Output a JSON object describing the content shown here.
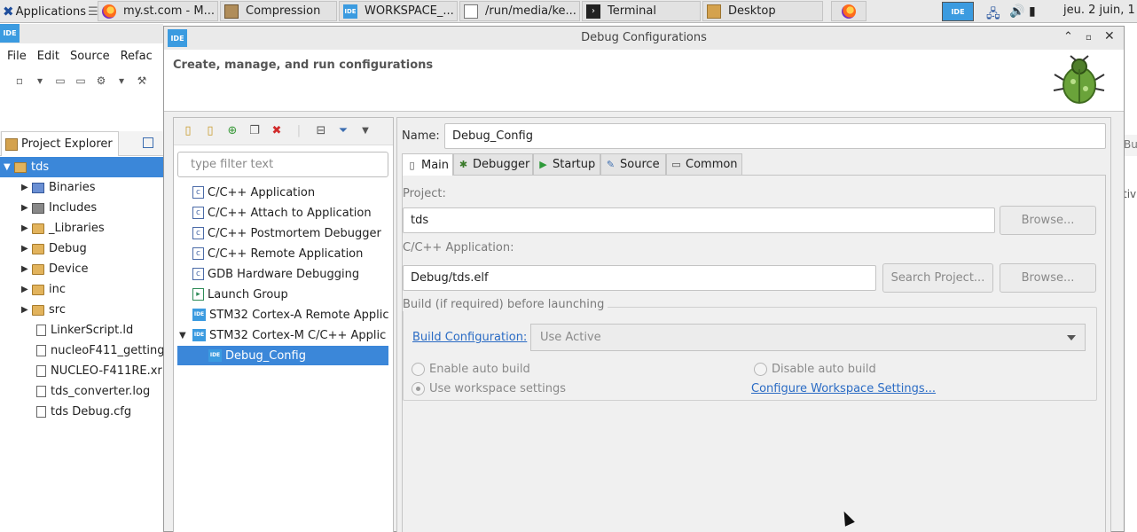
{
  "taskbar": {
    "applications_label": "Applications",
    "windows": [
      {
        "label": "my.st.com - M...",
        "icon": "firefox-icon"
      },
      {
        "label": "Compression",
        "icon": "archive-icon"
      },
      {
        "label": "WORKSPACE_...",
        "icon": "ide-icon"
      },
      {
        "label": "/run/media/ke...",
        "icon": "text-editor-icon"
      },
      {
        "label": "Terminal",
        "icon": "terminal-icon"
      },
      {
        "label": "Desktop",
        "icon": "folder-icon"
      }
    ],
    "clock": "jeu.  2 juin, 1"
  },
  "ide": {
    "badge": "IDE",
    "menu": [
      "File",
      "Edit",
      "Source",
      "Refac"
    ],
    "project_explorer": {
      "tab_label": "Project Explorer",
      "items": [
        {
          "label": "tds",
          "expanded": true,
          "selected": true,
          "icon": "project-icon"
        },
        {
          "label": "Binaries",
          "icon": "binaries-icon",
          "expandable": true
        },
        {
          "label": "Includes",
          "icon": "includes-icon",
          "expandable": true
        },
        {
          "label": "_Libraries",
          "icon": "folder-icon",
          "expandable": true
        },
        {
          "label": "Debug",
          "icon": "folder-icon",
          "expandable": true
        },
        {
          "label": "Device",
          "icon": "folder-icon",
          "expandable": true
        },
        {
          "label": "inc",
          "icon": "folder-icon",
          "expandable": true
        },
        {
          "label": "src",
          "icon": "folder-icon",
          "expandable": true
        },
        {
          "label": "LinkerScript.ld",
          "icon": "file-icon"
        },
        {
          "label": "nucleoF411_getting",
          "icon": "file-icon"
        },
        {
          "label": "NUCLEO-F411RE.xr",
          "icon": "file-icon"
        },
        {
          "label": "tds_converter.log",
          "icon": "file-icon"
        },
        {
          "label": "tds Debug.cfg",
          "icon": "file-icon"
        }
      ]
    },
    "right_fragments": [
      "Bui",
      "tiv"
    ]
  },
  "dialog": {
    "title": "Debug Configurations",
    "header_message": "Create, manage, and run configurations",
    "filter_placeholder": "type filter text",
    "config_types": [
      {
        "label": "C/C++ Application",
        "icon": "c-icon"
      },
      {
        "label": "C/C++ Attach to Application",
        "icon": "c-icon"
      },
      {
        "label": "C/C++ Postmortem Debugger",
        "icon": "c-icon"
      },
      {
        "label": "C/C++ Remote Application",
        "icon": "c-icon"
      },
      {
        "label": "GDB Hardware Debugging",
        "icon": "c-icon"
      },
      {
        "label": "Launch Group",
        "icon": "launch-group-icon"
      },
      {
        "label": "STM32 Cortex-A Remote Applic",
        "icon": "ide-icon"
      },
      {
        "label": "STM32 Cortex-M C/C++ Applic",
        "icon": "ide-icon",
        "expanded": true
      },
      {
        "label": "Debug_Config",
        "icon": "ide-icon",
        "selected": true,
        "child": true
      }
    ],
    "name_label": "Name:",
    "name_value": "Debug_Config",
    "tabs": [
      {
        "label": "Main",
        "icon": "main-tab-icon",
        "active": true
      },
      {
        "label": "Debugger",
        "icon": "debugger-icon"
      },
      {
        "label": "Startup",
        "icon": "startup-icon"
      },
      {
        "label": "Source",
        "icon": "source-icon"
      },
      {
        "label": "Common",
        "icon": "common-icon"
      }
    ],
    "main": {
      "project_label": "Project:",
      "project_value": "tds",
      "browse_label": "Browse...",
      "application_label": "C/C++ Application:",
      "application_value": "Debug/tds.elf",
      "search_project_label": "Search Project...",
      "browse2_label": "Browse...",
      "build_group_title": "Build (if required) before launching",
      "build_config_link": "Build Configuration:",
      "build_config_value": "Use Active",
      "enable_auto_build": "Enable auto build",
      "disable_auto_build": "Disable auto build",
      "use_workspace_settings": "Use workspace settings",
      "configure_workspace_link": "Configure Workspace Settings..."
    }
  }
}
